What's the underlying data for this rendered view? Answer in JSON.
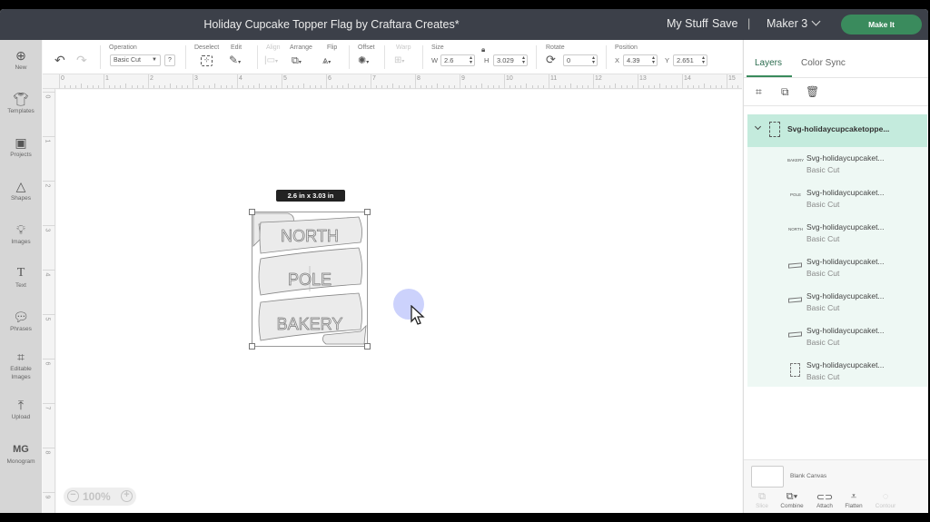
{
  "window": {
    "title": "Holiday Cupcake Topper Flag by Craftara Creates*"
  },
  "header": {
    "my_stuff": "My Stuff",
    "save": "Save",
    "separator": "|",
    "machine": "Maker 3",
    "make_it": "Make It",
    "colors": {
      "bar": "#3c4049",
      "make_it": "#3a8b5d"
    }
  },
  "toolbar": {
    "undo_icon": "undo-icon",
    "redo_icon": "redo-icon",
    "operation_label": "Operation",
    "operation_value": "Basic Cut",
    "help": "?",
    "deselect_label": "Deselect",
    "edit_label": "Edit",
    "align_label": "Align",
    "arrange_label": "Arrange",
    "flip_label": "Flip",
    "offset_label": "Offset",
    "warp_label": "Warp",
    "size_label": "Size",
    "w_label": "W",
    "w_value": "2.6",
    "h_label": "H",
    "h_value": "3.029",
    "rotate_label": "Rotate",
    "rotate_value": "0",
    "position_label": "Position",
    "x_label": "X",
    "x_value": "4.39",
    "y_label": "Y",
    "y_value": "2.651"
  },
  "sidebar": {
    "items": [
      {
        "label": "New",
        "icon": "plus-circle-icon"
      },
      {
        "label": "Templates",
        "icon": "shirt-icon"
      },
      {
        "label": "Projects",
        "icon": "projects-icon"
      },
      {
        "label": "Shapes",
        "icon": "shapes-icon"
      },
      {
        "label": "Images",
        "icon": "lightbulb-icon"
      },
      {
        "label": "Text",
        "icon": "text-icon"
      },
      {
        "label": "Phrases",
        "icon": "speech-bubble-icon"
      },
      {
        "label": "Editable",
        "label2": "Images",
        "icon": "editable-images-icon"
      },
      {
        "label": "Upload",
        "icon": "upload-icon"
      },
      {
        "label": "Monogram",
        "icon": "monogram-icon"
      }
    ]
  },
  "ruler": {
    "top": [
      "0",
      "1",
      "2",
      "3",
      "4",
      "5",
      "6",
      "7",
      "8",
      "9",
      "10",
      "11",
      "12",
      "13",
      "14",
      "15"
    ],
    "left": [
      "0",
      "1",
      "2",
      "3",
      "4",
      "5",
      "6",
      "7",
      "8",
      "9"
    ]
  },
  "canvas": {
    "size_tooltip": "2.6  in x 3.03  in",
    "design_words": [
      "NORTH",
      "POLE",
      "BAKERY"
    ],
    "zoom_minus": "−",
    "zoom_value": "100%",
    "zoom_plus": "+"
  },
  "panel": {
    "tabs": [
      "Layers",
      "Color Sync"
    ],
    "active_tab": "Layers",
    "group": {
      "name": "Svg-holidaycupcaketoppe..."
    },
    "layers": [
      {
        "name": "Svg-holidaycupcaket...",
        "operation": "Basic Cut",
        "thumb": "BAKERY"
      },
      {
        "name": "Svg-holidaycupcaket...",
        "operation": "Basic Cut",
        "thumb": "POLE"
      },
      {
        "name": "Svg-holidaycupcaket...",
        "operation": "Basic Cut",
        "thumb": "NORTH"
      },
      {
        "name": "Svg-holidaycupcaket...",
        "operation": "Basic Cut",
        "thumb": ""
      },
      {
        "name": "Svg-holidaycupcaket...",
        "operation": "Basic Cut",
        "thumb": ""
      },
      {
        "name": "Svg-holidaycupcaket...",
        "operation": "Basic Cut",
        "thumb": ""
      },
      {
        "name": "Svg-holidaycupcaket...",
        "operation": "Basic Cut",
        "thumb": ""
      }
    ],
    "blank_canvas": "Blank Canvas",
    "bottom_tools": [
      "Slice",
      "Combine",
      "Attach",
      "Flatten",
      "Contour"
    ]
  }
}
